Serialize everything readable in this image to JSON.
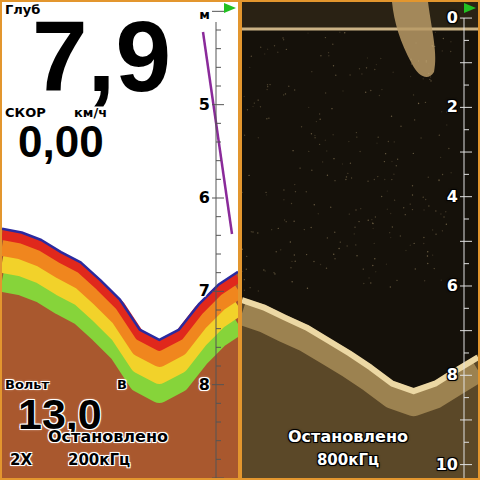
{
  "sonar_2d": {
    "depth_label": "Глуб",
    "depth": "7,9",
    "depth_unit": "м",
    "speed_label": "СКОР",
    "speed_unit": "км/ч",
    "speed": "0,00",
    "voltage_label": "Вольт",
    "voltage_unit": "В",
    "voltage": "13,0",
    "status": "Остановлено",
    "zoom": "2X",
    "frequency": "200кГц",
    "scale": {
      "min": 3.9,
      "max": 9.0,
      "ticks": [
        "5",
        "6",
        "7",
        "8"
      ]
    },
    "bottom_profile": [
      6.33,
      6.37,
      6.45,
      6.58,
      6.69,
      6.88,
      7.09,
      7.41,
      7.52,
      7.41,
      7.14,
      6.93,
      6.79
    ]
  },
  "downscan": {
    "status": "Остановлено",
    "frequency": "800кГц",
    "scale": {
      "min": -0.36,
      "max": 10.3,
      "ticks": [
        "0",
        "2",
        "4",
        "6",
        "8",
        "10"
      ]
    },
    "bottom_profile": [
      6.25,
      6.41,
      6.64,
      6.86,
      7.15,
      7.44,
      7.76,
      8.12,
      8.29,
      8.12,
      7.82,
      7.53
    ]
  }
}
